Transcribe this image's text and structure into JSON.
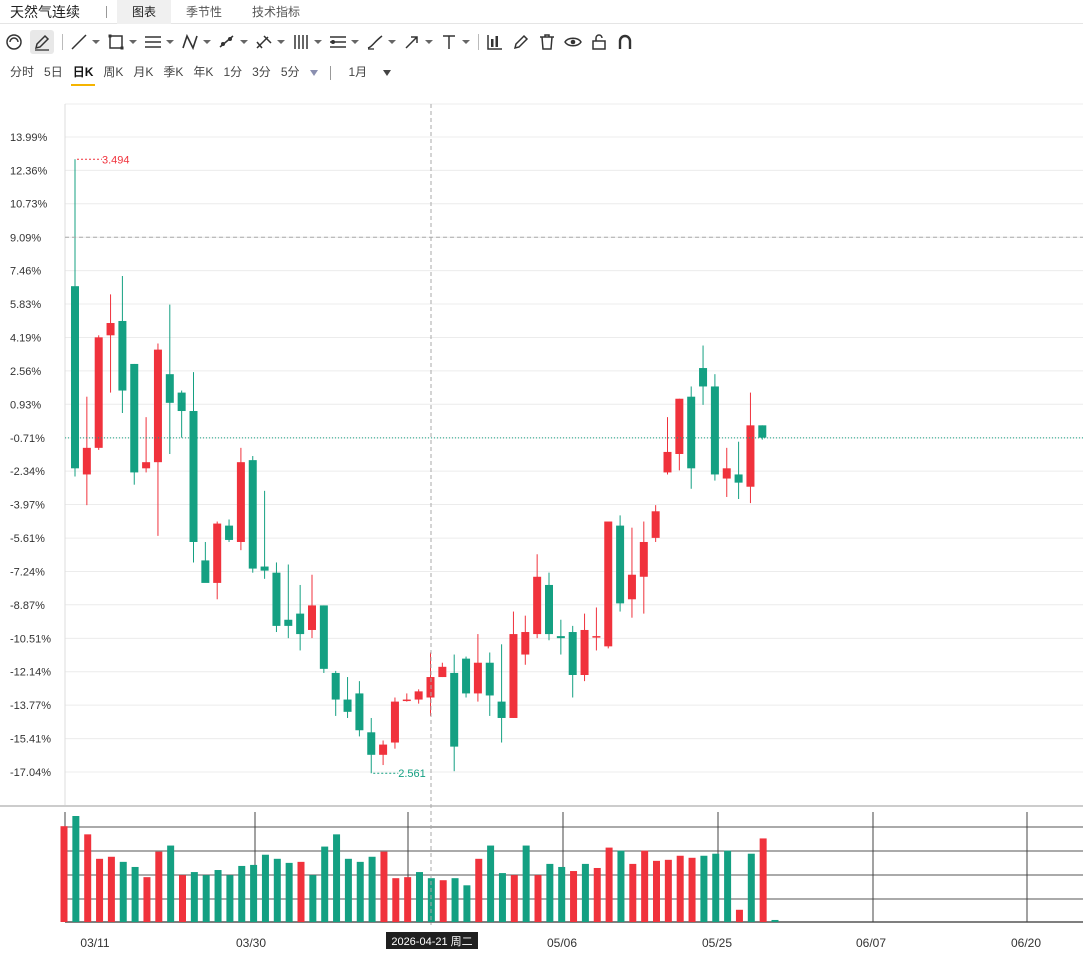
{
  "window": {
    "title": "天然气连续",
    "tabs": [
      {
        "label": "图表",
        "active": true
      },
      {
        "label": "季节性",
        "active": false
      },
      {
        "label": "技术指标",
        "active": false
      }
    ]
  },
  "toolbar": {
    "tools": [
      "cycle-icon",
      "pencil-icon",
      "line-icon",
      "rectangle-icon",
      "channel-icon",
      "pattern-icon",
      "measure-icon",
      "fib-icon",
      "columns-icon",
      "range-icon",
      "brush-icon",
      "arrow-icon",
      "text-icon",
      "indicator-icon",
      "edit-icon",
      "trash-icon",
      "eye-icon",
      "lock-icon",
      "magnet-icon"
    ]
  },
  "periods": {
    "items": [
      "分时",
      "5日",
      "日K",
      "周K",
      "月K",
      "季K",
      "年K",
      "1分",
      "3分",
      "5分"
    ],
    "active": "日K",
    "range": "1月"
  },
  "colors": {
    "up": "#f0323c",
    "down": "#14a082",
    "grid": "#ececec",
    "crosshair": "#aaaaaa"
  },
  "chart_data": {
    "type": "candlestick",
    "y_unit": "%",
    "y_ticks": [
      "13.99%",
      "12.36%",
      "10.73%",
      "9.09%",
      "7.46%",
      "5.83%",
      "4.19%",
      "2.56%",
      "0.93%",
      "-0.71%",
      "-2.34%",
      "-3.97%",
      "-5.61%",
      "-7.24%",
      "-8.87%",
      "-10.51%",
      "-12.14%",
      "-13.77%",
      "-15.41%",
      "-17.04%"
    ],
    "ylim": [
      -17.04,
      13.99
    ],
    "x_ticks": [
      "03/11",
      "03/30",
      "05/06",
      "05/25",
      "06/07",
      "06/20"
    ],
    "max_label": "3.494",
    "min_label": "2.561",
    "crosshair_label": "2026-04-21 周二",
    "crosshair_y": 9.09,
    "reference_y": -0.71,
    "candles": [
      {
        "o": 6.7,
        "h": 12.9,
        "l": -2.6,
        "c": -2.2
      },
      {
        "o": -2.5,
        "h": 1.3,
        "l": -4.0,
        "c": -1.2
      },
      {
        "o": -1.2,
        "h": 4.3,
        "l": -1.3,
        "c": 4.2
      },
      {
        "o": 4.3,
        "h": 6.3,
        "l": 1.5,
        "c": 4.9
      },
      {
        "o": 5.0,
        "h": 7.2,
        "l": 0.5,
        "c": 1.6
      },
      {
        "o": 2.9,
        "h": 2.9,
        "l": -3.0,
        "c": -2.4
      },
      {
        "o": -2.2,
        "h": 0.3,
        "l": -2.4,
        "c": -1.9
      },
      {
        "o": -1.9,
        "h": 3.9,
        "l": -5.5,
        "c": 3.6
      },
      {
        "o": 2.4,
        "h": 5.8,
        "l": -1.5,
        "c": 1.0
      },
      {
        "o": 1.5,
        "h": 1.6,
        "l": -0.7,
        "c": 0.6
      },
      {
        "o": 0.6,
        "h": 2.5,
        "l": -6.8,
        "c": -5.8
      },
      {
        "o": -6.7,
        "h": -5.8,
        "l": -7.5,
        "c": -7.8
      },
      {
        "o": -7.8,
        "h": -4.8,
        "l": -8.6,
        "c": -4.9
      },
      {
        "o": -5.0,
        "h": -4.7,
        "l": -5.8,
        "c": -5.7
      },
      {
        "o": -5.8,
        "h": -1.2,
        "l": -6.2,
        "c": -1.9
      },
      {
        "o": -1.8,
        "h": -1.6,
        "l": -7.3,
        "c": -7.1
      },
      {
        "o": -7.0,
        "h": -3.3,
        "l": -7.6,
        "c": -7.2
      },
      {
        "o": -7.3,
        "h": -6.8,
        "l": -10.2,
        "c": -9.9
      },
      {
        "o": -9.6,
        "h": -6.9,
        "l": -10.5,
        "c": -9.9
      },
      {
        "o": -9.3,
        "h": -7.9,
        "l": -11.1,
        "c": -10.3
      },
      {
        "o": -10.1,
        "h": -7.4,
        "l": -10.5,
        "c": -8.9
      },
      {
        "o": -8.9,
        "h": -8.9,
        "l": -12.2,
        "c": -12.0
      },
      {
        "o": -12.2,
        "h": -12.1,
        "l": -14.3,
        "c": -13.5
      },
      {
        "o": -13.5,
        "h": -12.4,
        "l": -14.4,
        "c": -14.1
      },
      {
        "o": -13.2,
        "h": -12.6,
        "l": -15.3,
        "c": -15.0
      },
      {
        "o": -15.1,
        "h": -14.4,
        "l": -17.1,
        "c": -16.2
      },
      {
        "o": -16.2,
        "h": -15.5,
        "l": -16.7,
        "c": -15.7
      },
      {
        "o": -15.6,
        "h": -13.4,
        "l": -15.9,
        "c": -13.6
      },
      {
        "o": -13.5,
        "h": -13.2,
        "l": -13.6,
        "c": -13.5
      },
      {
        "o": -13.5,
        "h": -13.0,
        "l": -13.7,
        "c": -13.1
      },
      {
        "o": -13.4,
        "h": -11.2,
        "l": -14.3,
        "c": -12.4
      },
      {
        "o": -12.4,
        "h": -11.7,
        "l": -12.4,
        "c": -11.9
      },
      {
        "o": -12.2,
        "h": -11.3,
        "l": -17.0,
        "c": -15.8
      },
      {
        "o": -11.5,
        "h": -11.4,
        "l": -13.4,
        "c": -13.2
      },
      {
        "o": -13.2,
        "h": -10.3,
        "l": -13.6,
        "c": -11.7
      },
      {
        "o": -11.7,
        "h": -11.2,
        "l": -14.3,
        "c": -13.3
      },
      {
        "o": -13.6,
        "h": -10.8,
        "l": -15.6,
        "c": -14.4
      },
      {
        "o": -14.4,
        "h": -9.2,
        "l": -14.4,
        "c": -10.3
      },
      {
        "o": -11.3,
        "h": -9.4,
        "l": -11.8,
        "c": -10.2
      },
      {
        "o": -10.3,
        "h": -6.4,
        "l": -10.5,
        "c": -7.5
      },
      {
        "o": -7.9,
        "h": -7.3,
        "l": -10.6,
        "c": -10.3
      },
      {
        "o": -10.4,
        "h": -9.6,
        "l": -11.3,
        "c": -10.5
      },
      {
        "o": -10.2,
        "h": -9.9,
        "l": -13.4,
        "c": -12.3
      },
      {
        "o": -12.3,
        "h": -9.3,
        "l": -12.6,
        "c": -10.1
      },
      {
        "o": -10.4,
        "h": -9.0,
        "l": -11.1,
        "c": -10.4
      },
      {
        "o": -10.9,
        "h": -5.1,
        "l": -11.0,
        "c": -4.8
      },
      {
        "o": -5.0,
        "h": -4.5,
        "l": -9.2,
        "c": -8.8
      },
      {
        "o": -8.6,
        "h": -5.1,
        "l": -9.5,
        "c": -7.4
      },
      {
        "o": -7.5,
        "h": -4.8,
        "l": -9.3,
        "c": -5.8
      },
      {
        "o": -5.6,
        "h": -4.0,
        "l": -5.8,
        "c": -4.3
      },
      {
        "o": -2.4,
        "h": 0.3,
        "l": -2.5,
        "c": -1.4
      },
      {
        "o": -1.5,
        "h": 1.2,
        "l": -2.3,
        "c": 1.2
      },
      {
        "o": 1.3,
        "h": 1.8,
        "l": -3.2,
        "c": -2.2
      },
      {
        "o": 2.7,
        "h": 3.8,
        "l": 0.9,
        "c": 1.8
      },
      {
        "o": 1.8,
        "h": 2.4,
        "l": -2.8,
        "c": -2.5
      },
      {
        "o": -2.7,
        "h": -1.2,
        "l": -3.6,
        "c": -2.2
      },
      {
        "o": -2.5,
        "h": -0.9,
        "l": -3.7,
        "c": -2.9
      },
      {
        "o": -3.1,
        "h": 1.5,
        "l": -3.9,
        "c": -0.1
      },
      {
        "o": -0.1,
        "h": -0.1,
        "l": -0.8,
        "c": -0.7
      }
    ],
    "volume": {
      "values": [
        94,
        104,
        86,
        62,
        64,
        59,
        54,
        44,
        69,
        75,
        46,
        49,
        46,
        51,
        46,
        55,
        56,
        66,
        62,
        58,
        59,
        46,
        74,
        86,
        62,
        59,
        64,
        69,
        43,
        44,
        49,
        43,
        41,
        43,
        36,
        62,
        75,
        48,
        46,
        75,
        46,
        57,
        54,
        50,
        57,
        53,
        73,
        70,
        57,
        70,
        60,
        61,
        65,
        63,
        65,
        67,
        70,
        12,
        67,
        82,
        2
      ],
      "up": [
        true,
        false,
        true,
        true,
        true,
        false,
        false,
        true,
        true,
        false,
        true,
        false,
        false,
        false,
        false,
        false,
        false,
        false,
        false,
        false,
        true,
        false,
        false,
        false,
        false,
        false,
        false,
        true,
        true,
        true,
        false,
        false,
        true,
        false,
        false,
        true,
        false,
        false,
        true,
        false,
        true,
        false,
        false,
        true,
        false,
        true,
        true,
        false,
        true,
        true,
        true,
        true,
        true,
        true,
        false,
        false,
        false,
        true,
        false,
        true,
        false
      ]
    }
  }
}
